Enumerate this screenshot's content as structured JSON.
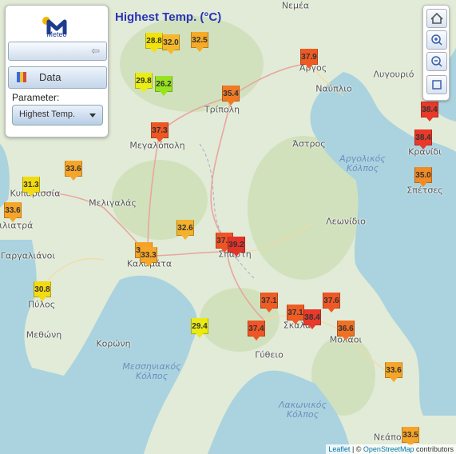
{
  "title": "Highest Temp. (°C)",
  "panel": {
    "logo_text": "Meteo",
    "data_button": "Data",
    "parameter_label": "Parameter:",
    "parameter_value": "Highest Temp."
  },
  "attribution": {
    "leaflet": "Leaflet",
    "sep": " | © ",
    "osm": "OpenStreetMap",
    "rest": " contributors"
  },
  "towns": [
    "Νεμέα",
    "Άργος",
    "Ναύπλιο",
    "Λυγουριό",
    "Τρίπολη",
    "Μεγαλόπολη",
    "Άστρος",
    "Κρανίδι",
    "Σπέτσες",
    "Κυπαρισσία",
    "Μελιγαλάς",
    "Φιλιατρά",
    "Λεωνίδιο",
    "Γαργαλιάνοι",
    "Καλαμάτα",
    "Σπάρτη",
    "Πύλος",
    "Μεθώνη",
    "Κορώνη",
    "Σκάλα",
    "Μολάοι",
    "Γύθειο",
    "Νεάπολη"
  ],
  "seas": [
    "Αργολικός Κόλπος",
    "Μεσσηνιακός Κόλπος",
    "Λακωνικός Κόλπος"
  ],
  "markers": [
    "28.8",
    "32.0",
    "32.5",
    "37.9",
    "29.8",
    "26.2",
    "35.4",
    "38.4",
    "37.3",
    "38.4",
    "33.6",
    "35.0",
    "31.3",
    "33.6",
    "32.6",
    "37.6",
    "39.2",
    "33.5",
    "33.3",
    "30.8",
    "37.1",
    "37.6",
    "37.1",
    "38.4",
    "29.4",
    "37.4",
    "36.6",
    "33.6",
    "33.5"
  ],
  "colors": {
    "sea": "#aad3df",
    "land": "#e3ebd9",
    "title": "#2a34b8"
  }
}
